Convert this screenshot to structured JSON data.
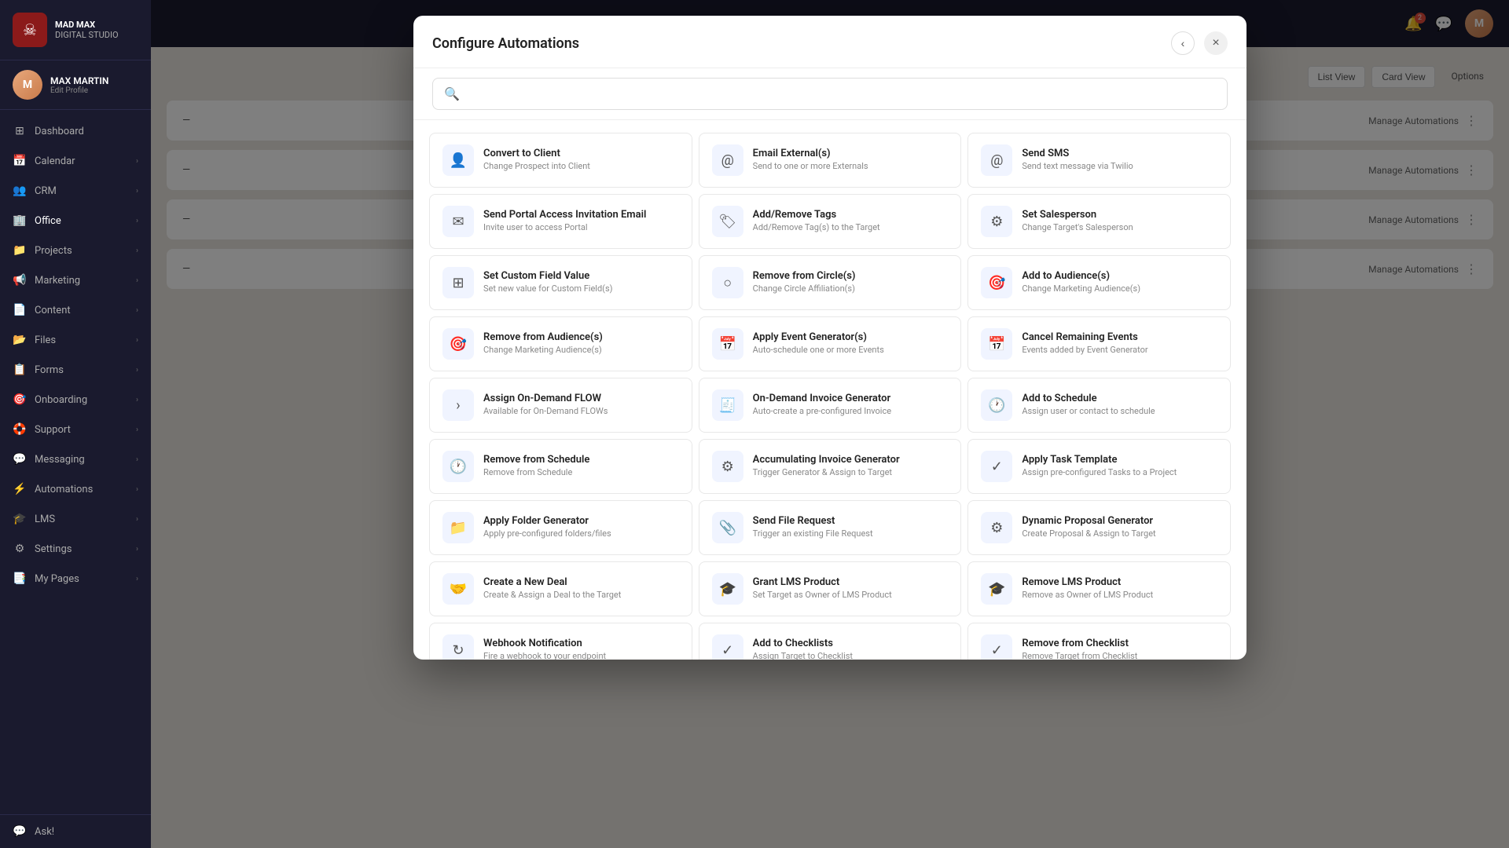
{
  "app": {
    "logo_line1": "MAD MAX",
    "logo_line2": "digital studio",
    "logo_icon": "☠"
  },
  "user": {
    "name": "MAX MARTIN",
    "edit_label": "Edit Profile",
    "initials": "M"
  },
  "sidebar": {
    "items": [
      {
        "id": "dashboard",
        "label": "Dashboard",
        "icon": "⊞",
        "has_chevron": false
      },
      {
        "id": "calendar",
        "label": "Calendar",
        "icon": "📅",
        "has_chevron": true
      },
      {
        "id": "crm",
        "label": "CRM",
        "icon": "👥",
        "has_chevron": true
      },
      {
        "id": "office",
        "label": "Office",
        "icon": "🏢",
        "has_chevron": true,
        "active": true
      },
      {
        "id": "projects",
        "label": "Projects",
        "icon": "📁",
        "has_chevron": true
      },
      {
        "id": "marketing",
        "label": "Marketing",
        "icon": "📢",
        "has_chevron": true
      },
      {
        "id": "content",
        "label": "Content",
        "icon": "📄",
        "has_chevron": true
      },
      {
        "id": "files",
        "label": "Files",
        "icon": "📂",
        "has_chevron": true
      },
      {
        "id": "forms",
        "label": "Forms",
        "icon": "📋",
        "has_chevron": true
      },
      {
        "id": "onboarding",
        "label": "Onboarding",
        "icon": "🎯",
        "has_chevron": true
      },
      {
        "id": "support",
        "label": "Support",
        "icon": "🛟",
        "has_chevron": true
      },
      {
        "id": "messaging",
        "label": "Messaging",
        "icon": "💬",
        "has_chevron": true
      },
      {
        "id": "automations",
        "label": "Automations",
        "icon": "⚡",
        "has_chevron": true
      },
      {
        "id": "lms",
        "label": "LMS",
        "icon": "🎓",
        "has_chevron": true
      },
      {
        "id": "settings",
        "label": "Settings",
        "icon": "⚙",
        "has_chevron": true
      },
      {
        "id": "my-pages",
        "label": "My Pages",
        "icon": "📑",
        "has_chevron": true
      }
    ],
    "ask_label": "Ask!"
  },
  "topbar": {
    "notification_count": "2"
  },
  "content_rows": [
    {
      "label": "Manage Automations"
    },
    {
      "label": "Manage Automations"
    },
    {
      "label": "Manage Automations"
    },
    {
      "label": "Manage Automations"
    }
  ],
  "views": {
    "list_view": "List View",
    "card_view": "Card View",
    "options": "Options"
  },
  "modal": {
    "title": "Configure Automations",
    "close_label": "×",
    "back_label": "‹",
    "search_placeholder": ""
  },
  "automations": [
    {
      "id": "convert-to-client",
      "title": "Convert to Client",
      "desc": "Change Prospect into Client",
      "icon": "👤"
    },
    {
      "id": "email-externals",
      "title": "Email External(s)",
      "desc": "Send to one or more Externals",
      "icon": "@"
    },
    {
      "id": "send-sms",
      "title": "Send SMS",
      "desc": "Send text message via Twilio",
      "icon": "@"
    },
    {
      "id": "send-portal-access",
      "title": "Send Portal Access Invitation Email",
      "desc": "Invite user to access Portal",
      "icon": "✉"
    },
    {
      "id": "add-remove-tags",
      "title": "Add/Remove Tags",
      "desc": "Add/Remove Tag(s) to the Target",
      "icon": "🏷"
    },
    {
      "id": "set-salesperson",
      "title": "Set Salesperson",
      "desc": "Change Target's Salesperson",
      "icon": "⚙"
    },
    {
      "id": "set-custom-field",
      "title": "Set Custom Field Value",
      "desc": "Set new value for Custom Field(s)",
      "icon": "⊞"
    },
    {
      "id": "remove-from-circle",
      "title": "Remove from Circle(s)",
      "desc": "Change Circle Affiliation(s)",
      "icon": "○"
    },
    {
      "id": "add-to-audiences",
      "title": "Add to Audience(s)",
      "desc": "Change Marketing Audience(s)",
      "icon": "🎯"
    },
    {
      "id": "remove-from-audiences",
      "title": "Remove from Audience(s)",
      "desc": "Change Marketing Audience(s)",
      "icon": "🎯"
    },
    {
      "id": "apply-event-generator",
      "title": "Apply Event Generator(s)",
      "desc": "Auto-schedule one or more Events",
      "icon": "📅"
    },
    {
      "id": "cancel-remaining-events",
      "title": "Cancel Remaining Events",
      "desc": "Events added by Event Generator",
      "icon": "📅"
    },
    {
      "id": "assign-on-demand-flow",
      "title": "Assign On-Demand FLOW",
      "desc": "Available for On-Demand FLOWs",
      "icon": "›"
    },
    {
      "id": "on-demand-invoice",
      "title": "On-Demand Invoice Generator",
      "desc": "Auto-create a pre-configured Invoice",
      "icon": "🧾"
    },
    {
      "id": "add-to-schedule",
      "title": "Add to Schedule",
      "desc": "Assign user or contact to schedule",
      "icon": "🕐"
    },
    {
      "id": "remove-from-schedule",
      "title": "Remove from Schedule",
      "desc": "Remove from Schedule",
      "icon": "🕐"
    },
    {
      "id": "accumulating-invoice",
      "title": "Accumulating Invoice Generator",
      "desc": "Trigger Generator & Assign to Target",
      "icon": "⚙"
    },
    {
      "id": "apply-task-template",
      "title": "Apply Task Template",
      "desc": "Assign pre-configured Tasks to a Project",
      "icon": "✓"
    },
    {
      "id": "apply-folder-generator",
      "title": "Apply Folder Generator",
      "desc": "Apply pre-configured folders/files",
      "icon": "📁"
    },
    {
      "id": "send-file-request",
      "title": "Send File Request",
      "desc": "Trigger an existing File Request",
      "icon": "📎"
    },
    {
      "id": "dynamic-proposal-generator",
      "title": "Dynamic Proposal Generator",
      "desc": "Create Proposal & Assign to Target",
      "icon": "⚙"
    },
    {
      "id": "create-new-deal",
      "title": "Create a New Deal",
      "desc": "Create & Assign a Deal to the Target",
      "icon": "🤝"
    },
    {
      "id": "grant-lms-product",
      "title": "Grant LMS Product",
      "desc": "Set Target as Owner of LMS Product",
      "icon": "🎓"
    },
    {
      "id": "remove-lms-product",
      "title": "Remove LMS Product",
      "desc": "Remove as Owner of LMS Product",
      "icon": "🎓"
    },
    {
      "id": "webhook-notification",
      "title": "Webhook Notification",
      "desc": "Fire a webhook to your endpoint",
      "icon": "↻"
    },
    {
      "id": "add-to-checklists",
      "title": "Add to Checklists",
      "desc": "Assign Target to Checklist",
      "icon": "✓"
    },
    {
      "id": "remove-from-checklist",
      "title": "Remove from Checklist",
      "desc": "Remove Target from Checklist",
      "icon": "✓"
    }
  ]
}
